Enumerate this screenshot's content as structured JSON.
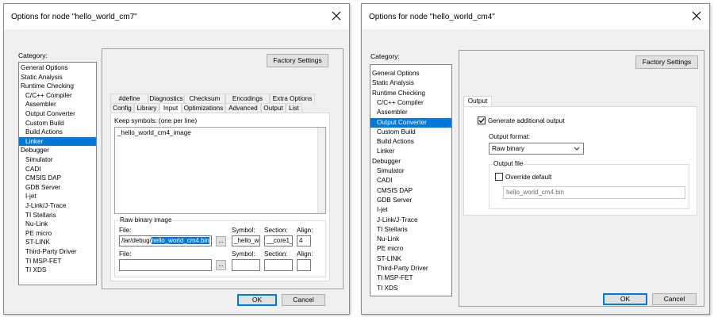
{
  "left_dialog": {
    "title": "Options for node \"hello_world_cm7\"",
    "category_label": "Category:",
    "categories": [
      {
        "label": "General Options",
        "level": 0
      },
      {
        "label": "Static Analysis",
        "level": 0
      },
      {
        "label": "Runtime Checking",
        "level": 0
      },
      {
        "label": "C/C++ Compiler",
        "level": 1
      },
      {
        "label": "Assembler",
        "level": 1
      },
      {
        "label": "Output Converter",
        "level": 1
      },
      {
        "label": "Custom Build",
        "level": 1
      },
      {
        "label": "Build Actions",
        "level": 1
      },
      {
        "label": "Linker",
        "level": 1
      },
      {
        "label": "Debugger",
        "level": 0
      },
      {
        "label": "Simulator",
        "level": 1
      },
      {
        "label": "CADI",
        "level": 1
      },
      {
        "label": "CMSIS DAP",
        "level": 1
      },
      {
        "label": "GDB Server",
        "level": 1
      },
      {
        "label": "I-jet",
        "level": 1
      },
      {
        "label": "J-Link/J-Trace",
        "level": 1
      },
      {
        "label": "TI Stellaris",
        "level": 1
      },
      {
        "label": "Nu-Link",
        "level": 1
      },
      {
        "label": "PE micro",
        "level": 1
      },
      {
        "label": "ST-LINK",
        "level": 1
      },
      {
        "label": "Third-Party Driver",
        "level": 1
      },
      {
        "label": "TI MSP-FET",
        "level": 1
      },
      {
        "label": "TI XDS",
        "level": 1
      }
    ],
    "selected_category": "Linker",
    "factory_settings": "Factory Settings",
    "tabs_row1": [
      "#define",
      "Diagnostics",
      "Checksum",
      "Encodings",
      "Extra Options"
    ],
    "tabs_row2": [
      "Config",
      "Library",
      "Input",
      "Optimizations",
      "Advanced",
      "Output",
      "List"
    ],
    "active_tab": "Input",
    "keep_symbols_label": "Keep symbols: (one per line)",
    "keep_symbols_value": "_hello_world_cm4_image",
    "raw_binary_group": "Raw binary image",
    "file_label": "File:",
    "symbol_label": "Symbol:",
    "section_label": "Section:",
    "align_label": "Align:",
    "row1": {
      "file_prefix": "/lar/debug/",
      "file_selected": "hello_world_cm4.bin",
      "symbol": "_hello_wo",
      "section": "__core1_",
      "align": "4"
    },
    "row2": {
      "file": "",
      "symbol": "",
      "section": "",
      "align": ""
    },
    "browse": "...",
    "ok": "OK",
    "cancel": "Cancel"
  },
  "right_dialog": {
    "title": "Options for node \"hello_world_cm4\"",
    "category_label": "Category:",
    "categories": [
      {
        "label": "General Options",
        "level": 0
      },
      {
        "label": "Static Analysis",
        "level": 0
      },
      {
        "label": "Runtime Checking",
        "level": 0
      },
      {
        "label": "C/C++ Compiler",
        "level": 1
      },
      {
        "label": "Assembler",
        "level": 1
      },
      {
        "label": "Output Converter",
        "level": 1
      },
      {
        "label": "Custom Build",
        "level": 1
      },
      {
        "label": "Build Actions",
        "level": 1
      },
      {
        "label": "Linker",
        "level": 1
      },
      {
        "label": "Debugger",
        "level": 0
      },
      {
        "label": "Simulator",
        "level": 1
      },
      {
        "label": "CADI",
        "level": 1
      },
      {
        "label": "CMSIS DAP",
        "level": 1
      },
      {
        "label": "GDB Server",
        "level": 1
      },
      {
        "label": "I-jet",
        "level": 1
      },
      {
        "label": "J-Link/J-Trace",
        "level": 1
      },
      {
        "label": "TI Stellaris",
        "level": 1
      },
      {
        "label": "Nu-Link",
        "level": 1
      },
      {
        "label": "PE micro",
        "level": 1
      },
      {
        "label": "ST-LINK",
        "level": 1
      },
      {
        "label": "Third-Party Driver",
        "level": 1
      },
      {
        "label": "TI MSP-FET",
        "level": 1
      },
      {
        "label": "TI XDS",
        "level": 1
      }
    ],
    "selected_category": "Output Converter",
    "factory_settings": "Factory Settings",
    "tab": "Output",
    "generate_label": "Generate additional output",
    "generate_checked": true,
    "output_format_label": "Output format:",
    "output_format_value": "Raw binary",
    "output_file_group": "Output file",
    "override_label": "Override default",
    "override_checked": false,
    "output_file_value": "hello_world_cm4.bin",
    "ok": "OK",
    "cancel": "Cancel"
  },
  "colors": {
    "selection": "#0078d7",
    "dialog_bg": "#f0f0f0",
    "button_bg": "#e1e1e1"
  }
}
